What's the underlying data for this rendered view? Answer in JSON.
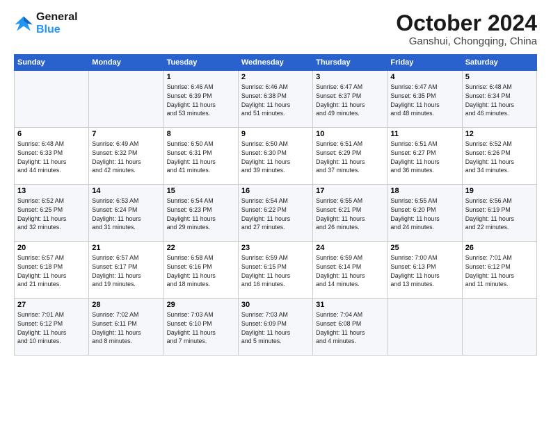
{
  "logo": {
    "line1": "General",
    "line2": "Blue"
  },
  "title": "October 2024",
  "location": "Ganshui, Chongqing, China",
  "weekdays": [
    "Sunday",
    "Monday",
    "Tuesday",
    "Wednesday",
    "Thursday",
    "Friday",
    "Saturday"
  ],
  "weeks": [
    [
      {
        "day": "",
        "info": ""
      },
      {
        "day": "",
        "info": ""
      },
      {
        "day": "1",
        "info": "Sunrise: 6:46 AM\nSunset: 6:39 PM\nDaylight: 11 hours\nand 53 minutes."
      },
      {
        "day": "2",
        "info": "Sunrise: 6:46 AM\nSunset: 6:38 PM\nDaylight: 11 hours\nand 51 minutes."
      },
      {
        "day": "3",
        "info": "Sunrise: 6:47 AM\nSunset: 6:37 PM\nDaylight: 11 hours\nand 49 minutes."
      },
      {
        "day": "4",
        "info": "Sunrise: 6:47 AM\nSunset: 6:35 PM\nDaylight: 11 hours\nand 48 minutes."
      },
      {
        "day": "5",
        "info": "Sunrise: 6:48 AM\nSunset: 6:34 PM\nDaylight: 11 hours\nand 46 minutes."
      }
    ],
    [
      {
        "day": "6",
        "info": "Sunrise: 6:48 AM\nSunset: 6:33 PM\nDaylight: 11 hours\nand 44 minutes."
      },
      {
        "day": "7",
        "info": "Sunrise: 6:49 AM\nSunset: 6:32 PM\nDaylight: 11 hours\nand 42 minutes."
      },
      {
        "day": "8",
        "info": "Sunrise: 6:50 AM\nSunset: 6:31 PM\nDaylight: 11 hours\nand 41 minutes."
      },
      {
        "day": "9",
        "info": "Sunrise: 6:50 AM\nSunset: 6:30 PM\nDaylight: 11 hours\nand 39 minutes."
      },
      {
        "day": "10",
        "info": "Sunrise: 6:51 AM\nSunset: 6:29 PM\nDaylight: 11 hours\nand 37 minutes."
      },
      {
        "day": "11",
        "info": "Sunrise: 6:51 AM\nSunset: 6:27 PM\nDaylight: 11 hours\nand 36 minutes."
      },
      {
        "day": "12",
        "info": "Sunrise: 6:52 AM\nSunset: 6:26 PM\nDaylight: 11 hours\nand 34 minutes."
      }
    ],
    [
      {
        "day": "13",
        "info": "Sunrise: 6:52 AM\nSunset: 6:25 PM\nDaylight: 11 hours\nand 32 minutes."
      },
      {
        "day": "14",
        "info": "Sunrise: 6:53 AM\nSunset: 6:24 PM\nDaylight: 11 hours\nand 31 minutes."
      },
      {
        "day": "15",
        "info": "Sunrise: 6:54 AM\nSunset: 6:23 PM\nDaylight: 11 hours\nand 29 minutes."
      },
      {
        "day": "16",
        "info": "Sunrise: 6:54 AM\nSunset: 6:22 PM\nDaylight: 11 hours\nand 27 minutes."
      },
      {
        "day": "17",
        "info": "Sunrise: 6:55 AM\nSunset: 6:21 PM\nDaylight: 11 hours\nand 26 minutes."
      },
      {
        "day": "18",
        "info": "Sunrise: 6:55 AM\nSunset: 6:20 PM\nDaylight: 11 hours\nand 24 minutes."
      },
      {
        "day": "19",
        "info": "Sunrise: 6:56 AM\nSunset: 6:19 PM\nDaylight: 11 hours\nand 22 minutes."
      }
    ],
    [
      {
        "day": "20",
        "info": "Sunrise: 6:57 AM\nSunset: 6:18 PM\nDaylight: 11 hours\nand 21 minutes."
      },
      {
        "day": "21",
        "info": "Sunrise: 6:57 AM\nSunset: 6:17 PM\nDaylight: 11 hours\nand 19 minutes."
      },
      {
        "day": "22",
        "info": "Sunrise: 6:58 AM\nSunset: 6:16 PM\nDaylight: 11 hours\nand 18 minutes."
      },
      {
        "day": "23",
        "info": "Sunrise: 6:59 AM\nSunset: 6:15 PM\nDaylight: 11 hours\nand 16 minutes."
      },
      {
        "day": "24",
        "info": "Sunrise: 6:59 AM\nSunset: 6:14 PM\nDaylight: 11 hours\nand 14 minutes."
      },
      {
        "day": "25",
        "info": "Sunrise: 7:00 AM\nSunset: 6:13 PM\nDaylight: 11 hours\nand 13 minutes."
      },
      {
        "day": "26",
        "info": "Sunrise: 7:01 AM\nSunset: 6:12 PM\nDaylight: 11 hours\nand 11 minutes."
      }
    ],
    [
      {
        "day": "27",
        "info": "Sunrise: 7:01 AM\nSunset: 6:12 PM\nDaylight: 11 hours\nand 10 minutes."
      },
      {
        "day": "28",
        "info": "Sunrise: 7:02 AM\nSunset: 6:11 PM\nDaylight: 11 hours\nand 8 minutes."
      },
      {
        "day": "29",
        "info": "Sunrise: 7:03 AM\nSunset: 6:10 PM\nDaylight: 11 hours\nand 7 minutes."
      },
      {
        "day": "30",
        "info": "Sunrise: 7:03 AM\nSunset: 6:09 PM\nDaylight: 11 hours\nand 5 minutes."
      },
      {
        "day": "31",
        "info": "Sunrise: 7:04 AM\nSunset: 6:08 PM\nDaylight: 11 hours\nand 4 minutes."
      },
      {
        "day": "",
        "info": ""
      },
      {
        "day": "",
        "info": ""
      }
    ]
  ]
}
